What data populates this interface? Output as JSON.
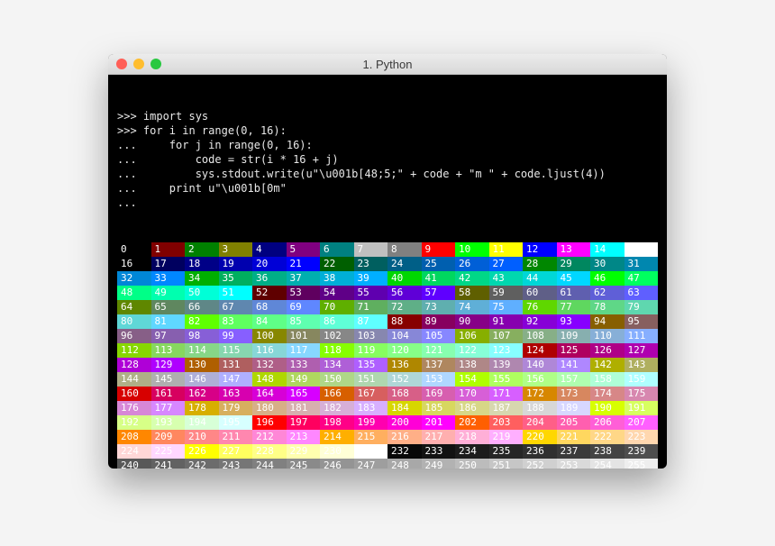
{
  "window": {
    "title": "1. Python",
    "lights": [
      "close",
      "minimize",
      "maximize"
    ]
  },
  "prompt": ">>> ",
  "cont": "... ",
  "code_lines": [
    ">>> import sys",
    ">>> for i in range(0, 16):",
    "...     for j in range(0, 16):",
    "...         code = str(i * 16 + j)",
    "...         sys.stdout.write(u\"\\u001b[48;5;\" + code + \"m \" + code.ljust(4))",
    "...     print u\"\\u001b[0m\"",
    "..."
  ],
  "final_prompt": ">>> ",
  "color_table": {
    "rows": 16,
    "cols": 16,
    "values": "0..255",
    "note": "xterm 256-color background palette; each cell shows its index on that background"
  },
  "xterm256": [
    "000000",
    "800000",
    "008000",
    "808000",
    "000080",
    "800080",
    "008080",
    "c0c0c0",
    "808080",
    "ff0000",
    "00ff00",
    "ffff00",
    "0000ff",
    "ff00ff",
    "00ffff",
    "ffffff",
    "000000",
    "00005f",
    "000087",
    "0000af",
    "0000d7",
    "0000ff",
    "005f00",
    "005f5f",
    "005f87",
    "005faf",
    "005fd7",
    "005fff",
    "008700",
    "00875f",
    "008787",
    "0087af",
    "0087d7",
    "0087ff",
    "00af00",
    "00af5f",
    "00af87",
    "00afaf",
    "00afd7",
    "00afff",
    "00d700",
    "00d75f",
    "00d787",
    "00d7af",
    "00d7d7",
    "00d7ff",
    "00ff00",
    "00ff5f",
    "00ff87",
    "00ffaf",
    "00ffd7",
    "00ffff",
    "5f0000",
    "5f005f",
    "5f0087",
    "5f00af",
    "5f00d7",
    "5f00ff",
    "5f5f00",
    "5f5f5f",
    "5f5f87",
    "5f5faf",
    "5f5fd7",
    "5f5fff",
    "5f8700",
    "5f875f",
    "5f8787",
    "5f87af",
    "5f87d7",
    "5f87ff",
    "5faf00",
    "5faf5f",
    "5faf87",
    "5fafaf",
    "5fafd7",
    "5fafff",
    "5fd700",
    "5fd75f",
    "5fd787",
    "5fd7af",
    "5fd7d7",
    "5fd7ff",
    "5fff00",
    "5fff5f",
    "5fff87",
    "5fffaf",
    "5fffd7",
    "5fffff",
    "870000",
    "87005f",
    "870087",
    "8700af",
    "8700d7",
    "8700ff",
    "875f00",
    "875f5f",
    "875f87",
    "875faf",
    "875fd7",
    "875fff",
    "878700",
    "87875f",
    "878787",
    "8787af",
    "8787d7",
    "8787ff",
    "87af00",
    "87af5f",
    "87af87",
    "87afaf",
    "87afd7",
    "87afff",
    "87d700",
    "87d75f",
    "87d787",
    "87d7af",
    "87d7d7",
    "87d7ff",
    "87ff00",
    "87ff5f",
    "87ff87",
    "87ffaf",
    "87ffd7",
    "87ffff",
    "af0000",
    "af005f",
    "af0087",
    "af00af",
    "af00d7",
    "af00ff",
    "af5f00",
    "af5f5f",
    "af5f87",
    "af5faf",
    "af5fd7",
    "af5fff",
    "af8700",
    "af875f",
    "af8787",
    "af87af",
    "af87d7",
    "af87ff",
    "afaf00",
    "afaf5f",
    "afaf87",
    "afafaf",
    "afafd7",
    "afafff",
    "afd700",
    "afd75f",
    "afd787",
    "afd7af",
    "afd7d7",
    "afd7ff",
    "afff00",
    "afff5f",
    "afff87",
    "afffaf",
    "afffd7",
    "afffff",
    "d70000",
    "d7005f",
    "d70087",
    "d700af",
    "d700d7",
    "d700ff",
    "d75f00",
    "d75f5f",
    "d75f87",
    "d75faf",
    "d75fd7",
    "d75fff",
    "d78700",
    "d7875f",
    "d78787",
    "d787af",
    "d787d7",
    "d787ff",
    "d7af00",
    "d7af5f",
    "d7af87",
    "d7afaf",
    "d7afd7",
    "d7afff",
    "d7d700",
    "d7d75f",
    "d7d787",
    "d7d7af",
    "d7d7d7",
    "d7d7ff",
    "d7ff00",
    "d7ff5f",
    "d7ff87",
    "d7ffaf",
    "d7ffd7",
    "d7ffff",
    "ff0000",
    "ff005f",
    "ff0087",
    "ff00af",
    "ff00d7",
    "ff00ff",
    "ff5f00",
    "ff5f5f",
    "ff5f87",
    "ff5faf",
    "ff5fd7",
    "ff5fff",
    "ff8700",
    "ff875f",
    "ff8787",
    "ff87af",
    "ff87d7",
    "ff87ff",
    "ffaf00",
    "ffaf5f",
    "ffaf87",
    "ffafaf",
    "ffafd7",
    "ffafff",
    "ffd700",
    "ffd75f",
    "ffd787",
    "ffd7af",
    "ffd7d7",
    "ffd7ff",
    "ffff00",
    "ffff5f",
    "ffff87",
    "ffffaf",
    "ffffd7",
    "ffffff",
    "080808",
    "121212",
    "1c1c1c",
    "262626",
    "303030",
    "3a3a3a",
    "444444",
    "4e4e4e",
    "585858",
    "626262",
    "6c6c6c",
    "767676",
    "808080",
    "8a8a8a",
    "949494",
    "9e9e9e",
    "a8a8a8",
    "b2b2b2",
    "bcbcbc",
    "c6c6c6",
    "d0d0d0",
    "dadada",
    "e4e4e4",
    "eeeeee"
  ]
}
